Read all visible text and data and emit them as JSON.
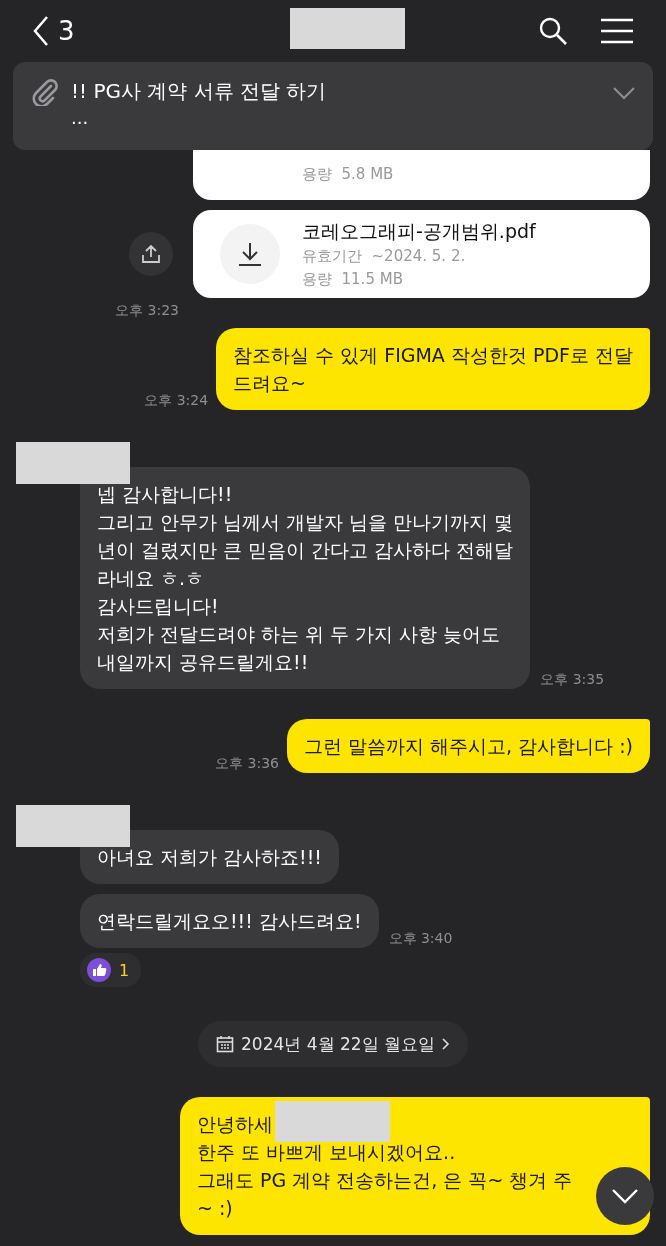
{
  "header": {
    "back_count": "3"
  },
  "notice": {
    "title": "!! PG사 계약 서류 전달 하기",
    "preview": "...",
    "expanded": false
  },
  "messages": [
    {
      "kind": "file",
      "partial": true,
      "size": "용량  5.8 MB"
    },
    {
      "kind": "file",
      "name": "코레오그래피-공개범위.pdf",
      "expiry": "유효기간  ~2024. 5. 2.",
      "size": "용량  11.5 MB",
      "time": "오후 3:23"
    },
    {
      "kind": "sent",
      "lines": [
        "참조하실 수 있게 FIGMA 작성한것 PDF로 전달",
        "드려요~"
      ],
      "time": "오후 3:24"
    },
    {
      "kind": "received",
      "avatar": true,
      "lines": [
        "넵 감사합니다!!",
        "그리고 안무가 님께서 개발자 님을 만나기까지 몇",
        "년이 걸렸지만 큰 믿음이 간다고 감사하다 전해달",
        "라네요 ㅎ.ㅎ",
        "감사드립니다!",
        "저희가 전달드려야 하는 위 두 가지 사항 늦어도",
        "내일까지 공유드릴게요!!"
      ],
      "time": "오후 3:35"
    },
    {
      "kind": "sent",
      "lines": [
        "그런 말씀까지 해주시고, 감사합니다 :)"
      ],
      "time": "오후 3:36"
    },
    {
      "kind": "received",
      "avatar": true,
      "lines": [
        "아녀요 저희가 감사하죠!!!"
      ]
    },
    {
      "kind": "received",
      "avatar": false,
      "lines": [
        "연락드릴게요오!!! 감사드려요!"
      ],
      "time": "오후 3:40",
      "reaction": {
        "count": "1"
      }
    },
    {
      "kind": "date",
      "label": "2024년 4월 22일 월요일"
    },
    {
      "kind": "sent",
      "lines": [
        "안녕하세",
        "한주 또 바쁘게 보내시겠어요..",
        "그래도 PG 계약 전송하는건, 은 꼭~ 챙겨 주",
        "~ :)"
      ]
    }
  ]
}
